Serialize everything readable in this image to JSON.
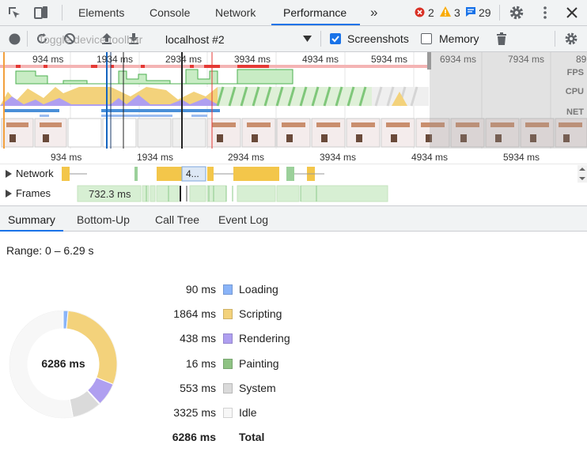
{
  "tabs": {
    "elements": "Elements",
    "console": "Console",
    "network": "Network",
    "performance": "Performance",
    "more": "»"
  },
  "badges": {
    "errors": "2",
    "warnings": "3",
    "messages": "29",
    "error_color": "#d93025",
    "warning_color": "#f9ab00",
    "message_color": "#1a73e8"
  },
  "toolbar": {
    "tooltip": "Toggle device toolbar",
    "profile": "localhost #2",
    "screenshots_label": "Screenshots",
    "screenshots_checked": true,
    "memory_label": "Memory",
    "memory_checked": false
  },
  "overview": {
    "ticks": [
      "934 ms",
      "1934 ms",
      "2934 ms",
      "3934 ms",
      "4934 ms",
      "5934 ms",
      "6934 ms",
      "7934 ms",
      "89"
    ],
    "lanes": [
      "FPS",
      "CPU",
      "NET"
    ]
  },
  "ruler": {
    "ticks": [
      "934 ms",
      "1934 ms",
      "2934 ms",
      "3934 ms",
      "4934 ms",
      "5934 ms"
    ]
  },
  "tracks": {
    "network": "Network",
    "frames": "Frames",
    "network_item": "4...",
    "frame_duration": "732.3 ms"
  },
  "subtabs": {
    "summary": "Summary",
    "bottom_up": "Bottom-Up",
    "call_tree": "Call Tree",
    "event_log": "Event Log"
  },
  "summary": {
    "range": "Range: 0 – 6.29 s",
    "total_center": "6286 ms",
    "rows": [
      {
        "value": "90 ms",
        "name": "Loading",
        "color": "#8ab4f8"
      },
      {
        "value": "1864 ms",
        "name": "Scripting",
        "color": "#f3d27b"
      },
      {
        "value": "438 ms",
        "name": "Rendering",
        "color": "#af9ff0"
      },
      {
        "value": "16 ms",
        "name": "Painting",
        "color": "#8fc384"
      },
      {
        "value": "553 ms",
        "name": "System",
        "color": "#dadada"
      },
      {
        "value": "3325 ms",
        "name": "Idle",
        "color": "#f7f7f7"
      }
    ],
    "total_value": "6286 ms",
    "total_label": "Total"
  },
  "chart_data": {
    "type": "pie",
    "categories": [
      "Loading",
      "Scripting",
      "Rendering",
      "Painting",
      "System",
      "Idle"
    ],
    "values": [
      90,
      1864,
      438,
      16,
      553,
      3325
    ],
    "colors": [
      "#8ab4f8",
      "#f3d27b",
      "#af9ff0",
      "#8fc384",
      "#dadada",
      "#f7f7f7"
    ],
    "title": "",
    "center_label": "6286 ms"
  }
}
